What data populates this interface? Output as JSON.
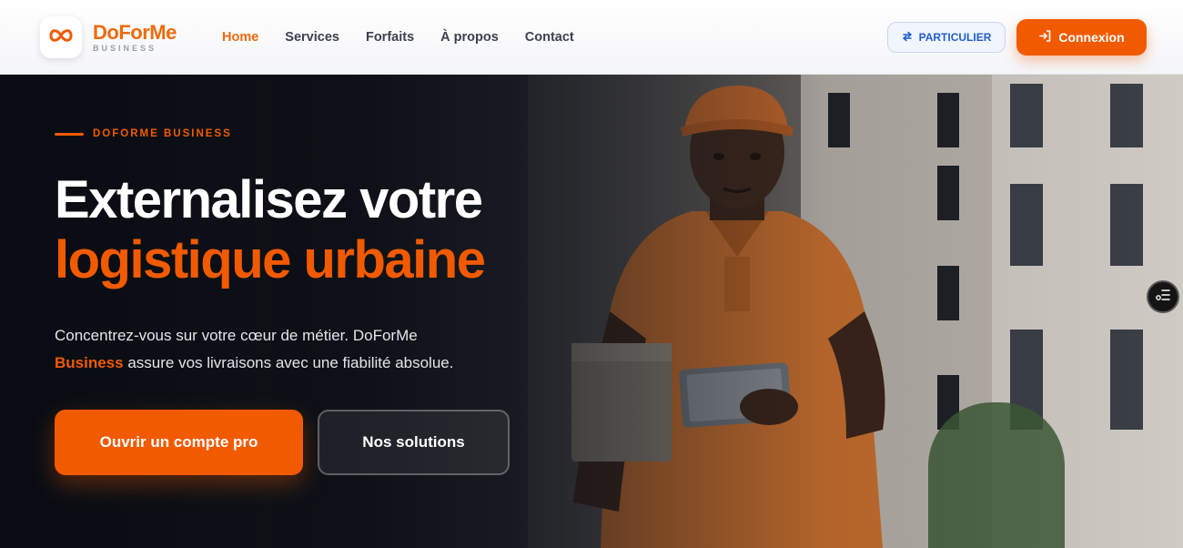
{
  "brand": {
    "name": "DoForMe",
    "subtitle": "BUSINESS",
    "logo_icon": "infinity-icon",
    "accent_color": "#f25a00"
  },
  "nav": {
    "items": [
      {
        "label": "Home",
        "active": true
      },
      {
        "label": "Services",
        "active": false
      },
      {
        "label": "Forfaits",
        "active": false
      },
      {
        "label": "À propos",
        "active": false
      },
      {
        "label": "Contact",
        "active": false
      }
    ]
  },
  "header_actions": {
    "particulier_label": "PARTICULIER",
    "particulier_icon": "swap-arrows-icon",
    "connexion_label": "Connexion",
    "connexion_icon": "login-arrow-icon"
  },
  "hero": {
    "eyebrow": "DOFORME BUSINESS",
    "title_line1": "Externalisez votre",
    "title_line2": "logistique urbaine",
    "description_part1": "Concentrez-vous sur votre cœur de métier. DoForMe",
    "description_highlight": "Business",
    "description_part2": "assure vos livraisons avec une fiabilité absolue.",
    "primary_button": "Ouvrir un compte pro",
    "secondary_button": "Nos solutions"
  },
  "side_widget": {
    "icon": "accessibility-menu-icon"
  }
}
